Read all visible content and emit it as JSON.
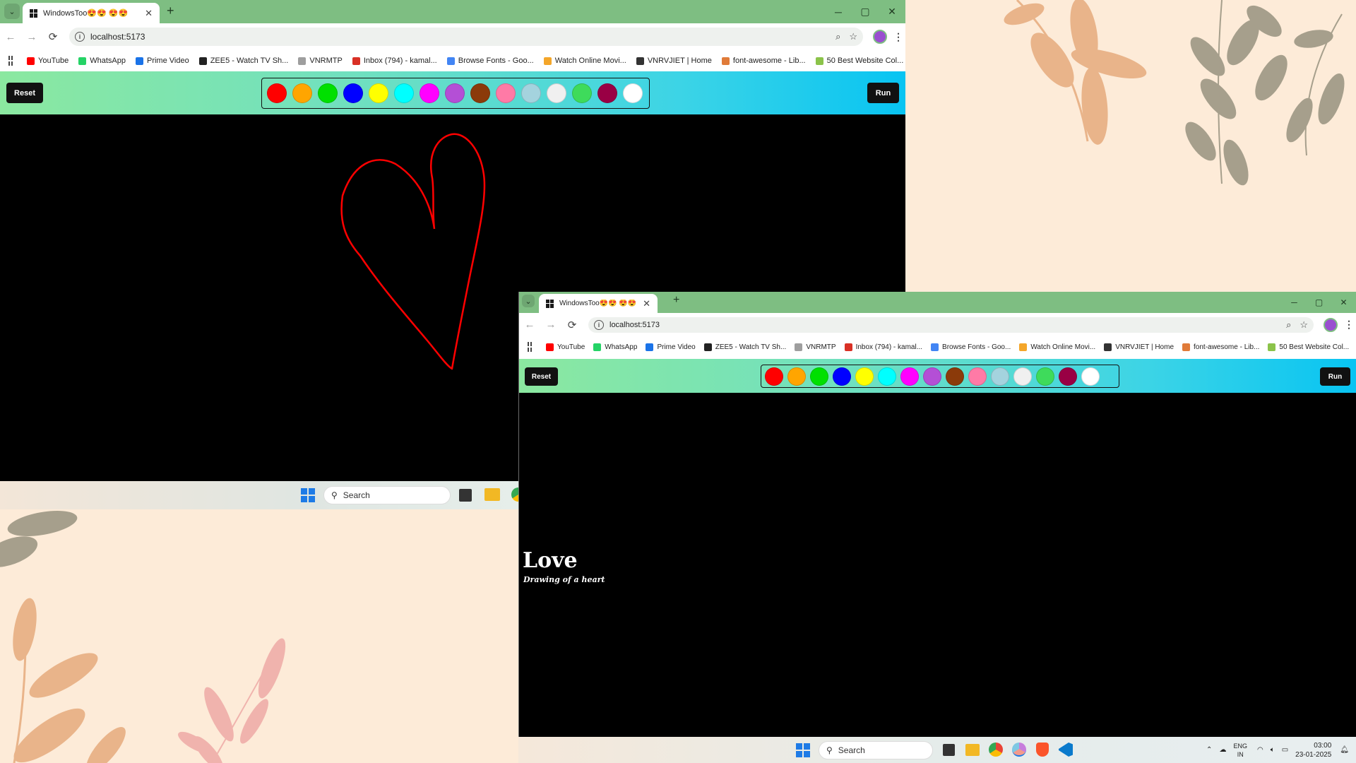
{
  "wallpaper": {
    "background": "#fdebd8"
  },
  "window1": {
    "tab": {
      "title": "WindowsToo😍😍 😍😍",
      "close": "✕"
    },
    "new_tab": "+",
    "controls": {
      "minimize": "─",
      "maximize": "▢",
      "close": "✕"
    },
    "nav": {
      "back": "←",
      "forward": "→",
      "reload": "⟳"
    },
    "address": {
      "url": "localhost:5173",
      "zoom_icon": "⌕",
      "star_icon": "☆"
    },
    "menu": "⋮",
    "bookmarks": [
      {
        "label": "YouTube",
        "color": "#ff0000"
      },
      {
        "label": "WhatsApp",
        "color": "#25d366"
      },
      {
        "label": "Prime Video",
        "color": "#1a73e8"
      },
      {
        "label": "ZEE5 - Watch TV Sh...",
        "color": "#222222"
      },
      {
        "label": "VNRMTP",
        "color": "#9e9e9e"
      },
      {
        "label": "Inbox (794) - kamal...",
        "color": "#d93025"
      },
      {
        "label": "Browse Fonts - Goo...",
        "color": "#4285f4"
      },
      {
        "label": "Watch Online Movi...",
        "color": "#f4a62a"
      },
      {
        "label": "VNRVJIET | Home",
        "color": "#333333"
      },
      {
        "label": "font-awesome - Lib...",
        "color": "#e07b39"
      },
      {
        "label": "50 Best Website Col...",
        "color": "#8bc34a"
      }
    ],
    "bookmarks_more": "»",
    "reset_label": "Reset",
    "run_label": "Run"
  },
  "window2": {
    "tab": {
      "title": "WindowsToo😍😍 😍😍",
      "close": "✕"
    },
    "new_tab": "+",
    "controls": {
      "minimize": "─",
      "maximize": "▢",
      "close": "✕"
    },
    "nav": {
      "back": "←",
      "forward": "→",
      "reload": "⟳"
    },
    "address": {
      "url": "localhost:5173",
      "zoom_icon": "⌕",
      "star_icon": "☆"
    },
    "menu": "⋮",
    "bookmarks_more": "»",
    "reset_label": "Reset",
    "run_label": "Run",
    "result": {
      "title": "Love",
      "subtitle": "Drawing of a heart"
    }
  },
  "palette": [
    "#ff0000",
    "#ffa500",
    "#00e000",
    "#0000ff",
    "#ffff00",
    "#00ffff",
    "#ff00ff",
    "#b44fd6",
    "#8b3a0a",
    "#ff7aa6",
    "#a4d3de",
    "#f0f0f0",
    "#3edb5b",
    "#990044",
    "#ffffff"
  ],
  "heart_color": "#ff0000",
  "taskbar": {
    "search_placeholder": "Search",
    "lang_line1": "ENG",
    "lang_line2": "IN",
    "time": "03:00",
    "date": "23-01-2025"
  },
  "taskbar_partial": {
    "search_placeholder": "Search"
  }
}
